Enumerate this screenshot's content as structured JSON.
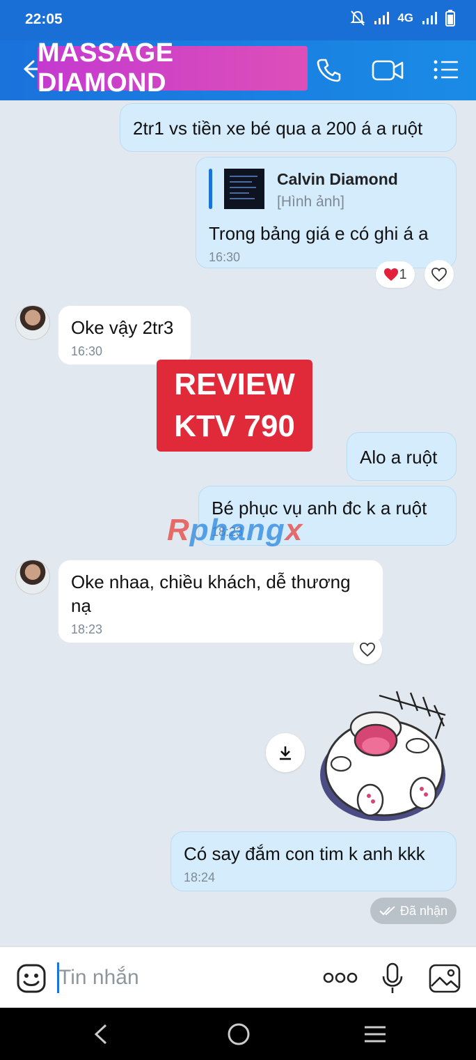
{
  "status_bar": {
    "time": "22:05",
    "network": "4G"
  },
  "header": {
    "title": "MASSAGE DIAMOND"
  },
  "messages": {
    "m1": {
      "text": "2tr1 vs tiền xe bé qua a 200 á a ruột"
    },
    "m2": {
      "quote_author": "Calvin Diamond",
      "quote_type": "[Hình ảnh]",
      "text": "Trong bảng giá e có ghi á a",
      "time": "16:30",
      "reaction_count": "1"
    },
    "m3": {
      "text": "Oke vậy 2tr3",
      "time": "16:30"
    },
    "m4": {
      "text": "Alo a ruột"
    },
    "m5": {
      "text": "Bé phục vụ anh đc k a ruột",
      "time": "18:23"
    },
    "m6": {
      "text": "Oke nhaa, chiều khách, dễ thương nạ",
      "time": "18:23"
    },
    "m7": {
      "text": "Có say đắm con tim k anh kkk",
      "time": "18:24"
    }
  },
  "overlay": {
    "review_line1": "REVIEW",
    "review_line2": "KTV 790",
    "watermark_a": "R",
    "watermark_b": "phang",
    "watermark_c": "x"
  },
  "seen_status": "Đã nhận",
  "composer": {
    "placeholder": "Tin nhắn"
  },
  "colors": {
    "header_blue": "#1a72db",
    "outgoing_bubble": "#d5ecfd",
    "incoming_bubble": "#ffffff",
    "review_red": "#e02a3a",
    "title_badge": "#c43ad0"
  },
  "icons": [
    "back-arrow-icon",
    "phone-icon",
    "video-call-icon",
    "menu-list-icon",
    "heart-icon",
    "download-icon",
    "sticker-icon",
    "more-icon",
    "mic-icon",
    "image-icon",
    "nav-back-icon",
    "nav-home-icon",
    "nav-recent-icon"
  ]
}
